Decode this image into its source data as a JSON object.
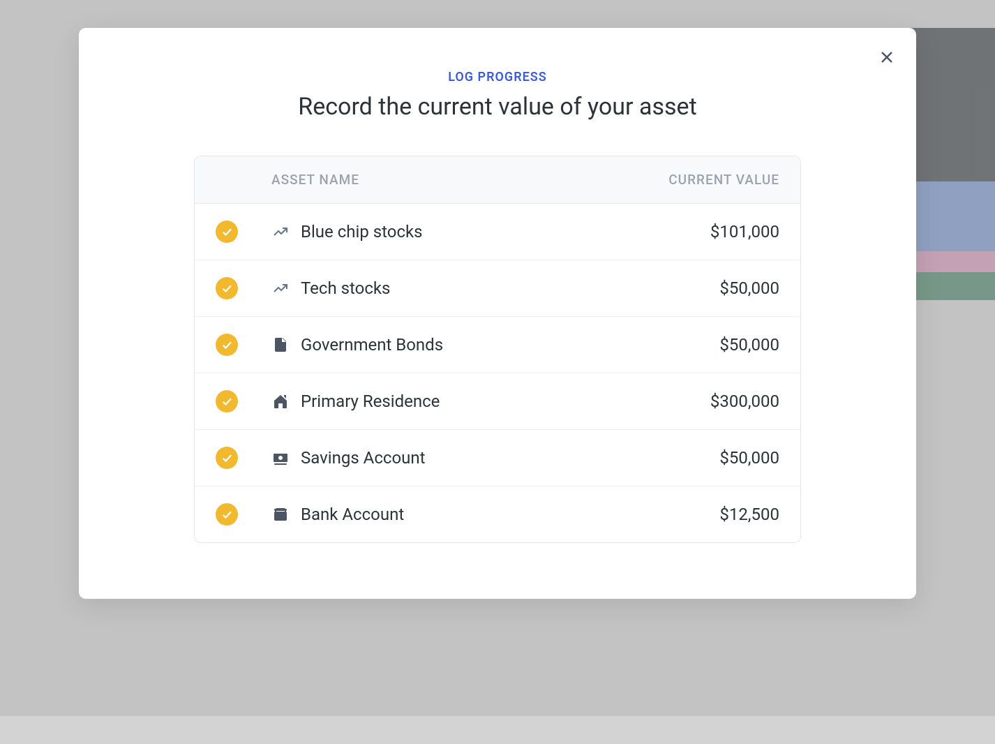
{
  "modal": {
    "eyebrow": "LOG PROGRESS",
    "title": "Record the current value of your asset"
  },
  "table": {
    "headers": {
      "name": "ASSET NAME",
      "value": "CURRENT VALUE"
    },
    "rows": [
      {
        "icon": "trending-up",
        "name": "Blue chip stocks",
        "value": "$101,000",
        "status": "done"
      },
      {
        "icon": "trending-up",
        "name": "Tech stocks",
        "value": "$50,000",
        "status": "done"
      },
      {
        "icon": "document",
        "name": "Government Bonds",
        "value": "$50,000",
        "status": "done"
      },
      {
        "icon": "home",
        "name": "Primary Residence",
        "value": "$300,000",
        "status": "done"
      },
      {
        "icon": "cash",
        "name": "Savings Account",
        "value": "$50,000",
        "status": "done"
      },
      {
        "icon": "wallet",
        "name": "Bank Account",
        "value": "$12,500",
        "status": "done"
      }
    ]
  },
  "colors": {
    "accent": "#3b5cde",
    "badge": "#f2b92f",
    "text_primary": "#2c3338",
    "text_muted": "#9ca3af",
    "icon_muted": "#64748b"
  }
}
